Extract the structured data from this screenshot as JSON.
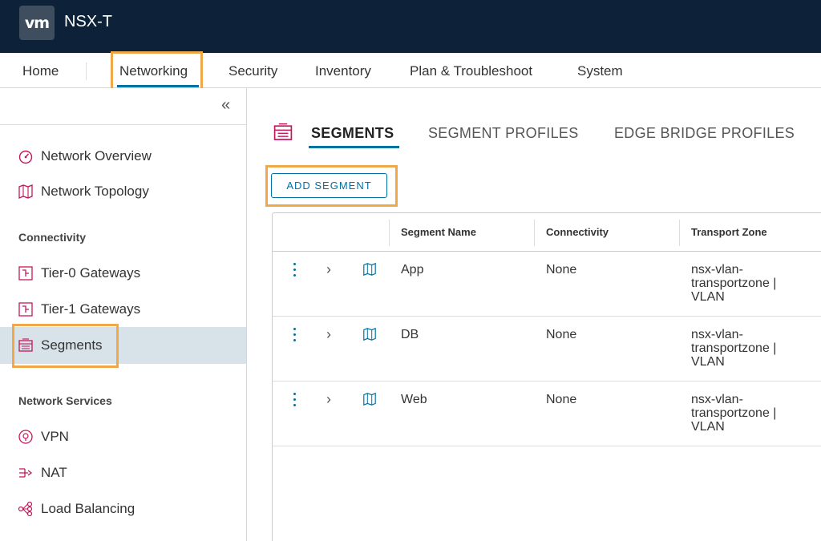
{
  "header": {
    "logo_text": "vm",
    "product": "NSX-T"
  },
  "topnav": {
    "items": [
      "Home",
      "Networking",
      "Security",
      "Inventory",
      "Plan & Troubleshoot",
      "System"
    ],
    "active": "Networking"
  },
  "sidebar": {
    "collapse_glyph": "«",
    "top_items": [
      {
        "label": "Network Overview",
        "icon": "gauge-icon"
      },
      {
        "label": "Network Topology",
        "icon": "topology-map-icon"
      }
    ],
    "sections": [
      {
        "title": "Connectivity",
        "items": [
          {
            "label": "Tier-0 Gateways",
            "icon": "tier0-gateway-icon"
          },
          {
            "label": "Tier-1 Gateways",
            "icon": "tier1-gateway-icon"
          },
          {
            "label": "Segments",
            "icon": "segments-icon",
            "active": true
          }
        ]
      },
      {
        "title": "Network Services",
        "items": [
          {
            "label": "VPN",
            "icon": "vpn-icon"
          },
          {
            "label": "NAT",
            "icon": "nat-icon"
          },
          {
            "label": "Load Balancing",
            "icon": "load-balancing-icon"
          }
        ]
      }
    ]
  },
  "main": {
    "tabs": [
      "SEGMENTS",
      "SEGMENT PROFILES",
      "EDGE BRIDGE PROFILES"
    ],
    "active_tab": "SEGMENTS",
    "add_button": "ADD SEGMENT",
    "columns": [
      "Segment Name",
      "Connectivity",
      "Transport Zone"
    ],
    "rows": [
      {
        "name": "App",
        "connectivity": "None",
        "tz": [
          "nsx-vlan-",
          "transportzone |",
          "VLAN"
        ]
      },
      {
        "name": "DB",
        "connectivity": "None",
        "tz": [
          "nsx-vlan-",
          "transportzone |",
          "VLAN"
        ]
      },
      {
        "name": "Web",
        "connectivity": "None",
        "tz": [
          "nsx-vlan-",
          "transportzone |",
          "VLAN"
        ]
      }
    ]
  },
  "colors": {
    "header_bg": "#0d2238",
    "accent_blue": "#0072a3",
    "icon_pink": "#c2185b",
    "highlight_orange": "#f0a848",
    "active_row_bg": "#d8e3e9"
  }
}
